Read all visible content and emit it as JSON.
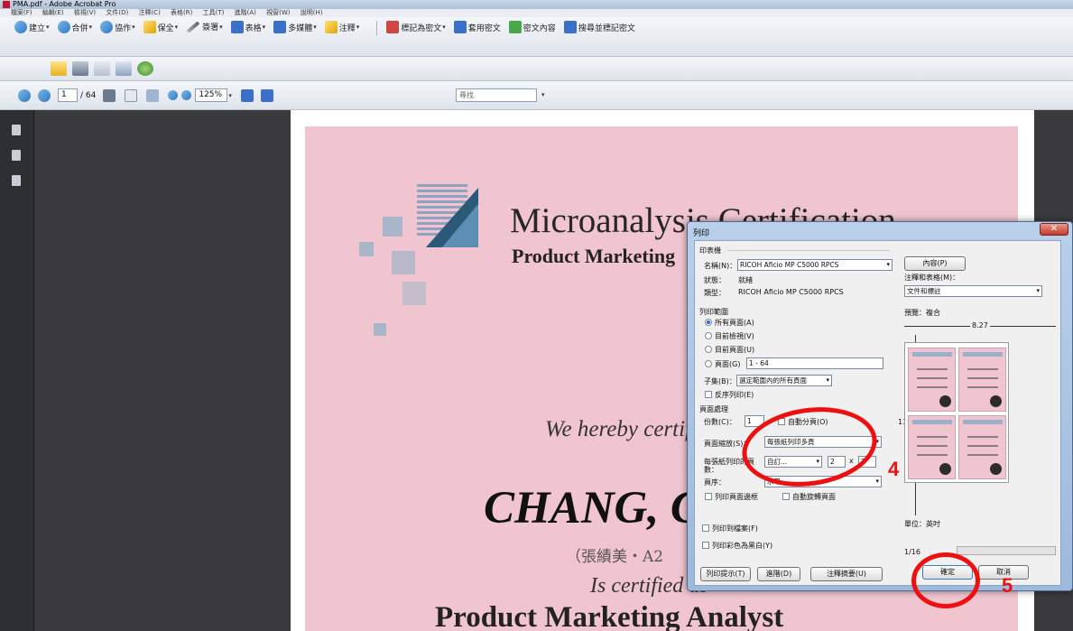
{
  "window": {
    "title": "PMA.pdf - Adobe Acrobat Pro"
  },
  "menu": [
    "檔案(F)",
    "編輯(E)",
    "檢視(V)",
    "文件(D)",
    "注釋(C)",
    "表格(R)",
    "工具(T)",
    "進階(A)",
    "視窗(W)",
    "說明(H)"
  ],
  "toolbar1": [
    {
      "label": "建立",
      "icon": "create-icon"
    },
    {
      "label": "合併",
      "icon": "combine-icon"
    },
    {
      "label": "協作",
      "icon": "collaborate-icon"
    },
    {
      "label": "保全",
      "icon": "secure-icon"
    },
    {
      "label": "簽署",
      "icon": "sign-icon"
    },
    {
      "label": "表格",
      "icon": "forms-icon"
    },
    {
      "label": "多媒體",
      "icon": "multimedia-icon"
    },
    {
      "label": "注釋",
      "icon": "comment-icon"
    }
  ],
  "toolbar1_right": [
    {
      "label": "標記為密文",
      "icon": "mark-redaction-icon"
    },
    {
      "label": "套用密文",
      "icon": "apply-redaction-icon"
    },
    {
      "label": "密文內容",
      "icon": "redaction-properties-icon"
    },
    {
      "label": "搜尋並標記密文",
      "icon": "search-redact-icon"
    }
  ],
  "nav": {
    "page_current": "1",
    "page_total": "/ 64",
    "zoom": "125%",
    "find_placeholder": "尋找"
  },
  "certificate": {
    "title": "Microanalysis Certification",
    "subtitle": "Product Marketing",
    "hereby": "We hereby certify that",
    "name": "CHANG, C",
    "chinese_name": "（張績美・A2",
    "is_certified": "Is certified as",
    "role": "Product Marketing Analyst"
  },
  "dialog": {
    "title": "列印",
    "printer_group": "印表機",
    "name_label": "名稱(N)：",
    "printer_name": "RICOH Aficio MP C5000 RPCS",
    "status_label": "狀態：",
    "status_value": "就緒",
    "type_label": "類型：",
    "type_value": "RICOH Aficio MP C5000 RPCS",
    "properties_button": "內容(P)",
    "comments_forms_label": "注釋和表格(M)：",
    "comments_forms_value": "文件和標註",
    "range_group": "列印範圍",
    "range_all": "所有頁面(A)",
    "range_view": "目前檢視(V)",
    "range_page": "目前頁面(U)",
    "range_pages": "頁面(G)",
    "range_pages_value": "1 - 64",
    "subset_label": "子集(B)：",
    "subset_value": "選定範圍內的所有頁面",
    "reverse_label": "反序列印(E)",
    "handling_group": "頁面處理",
    "copies_label": "份數(C)：",
    "copies_value": "1",
    "collate_label": "自動分頁(O)",
    "scaling_label": "頁面縮放(S)：",
    "scaling_value": "每張紙列印多頁",
    "per_sheet_label": "每張紙列印的頁數：",
    "per_sheet_value": "自訂...",
    "per_sheet_x": "2",
    "per_sheet_times": "x",
    "per_sheet_y": "2",
    "order_label": "頁序：",
    "order_value": "水平",
    "borders_label": "列印頁面邊框",
    "autorotate_label": "自動旋轉頁面",
    "print_to_file": "列印到檔案(F)",
    "print_grayscale": "列印彩色為黑白(Y)",
    "preview_label": "預覽：複合",
    "width_label": "8.27",
    "height_label": "11.69",
    "units_label": "單位：英吋",
    "page_of": "1/16",
    "tips_button": "列印提示(T)",
    "advanced_button": "進階(D)",
    "summarize_button": "注釋摘要(U)",
    "ok_button": "確定",
    "cancel_button": "取消"
  },
  "annotations": {
    "step4": "4",
    "step5": "5",
    "color": "#ee1010"
  }
}
